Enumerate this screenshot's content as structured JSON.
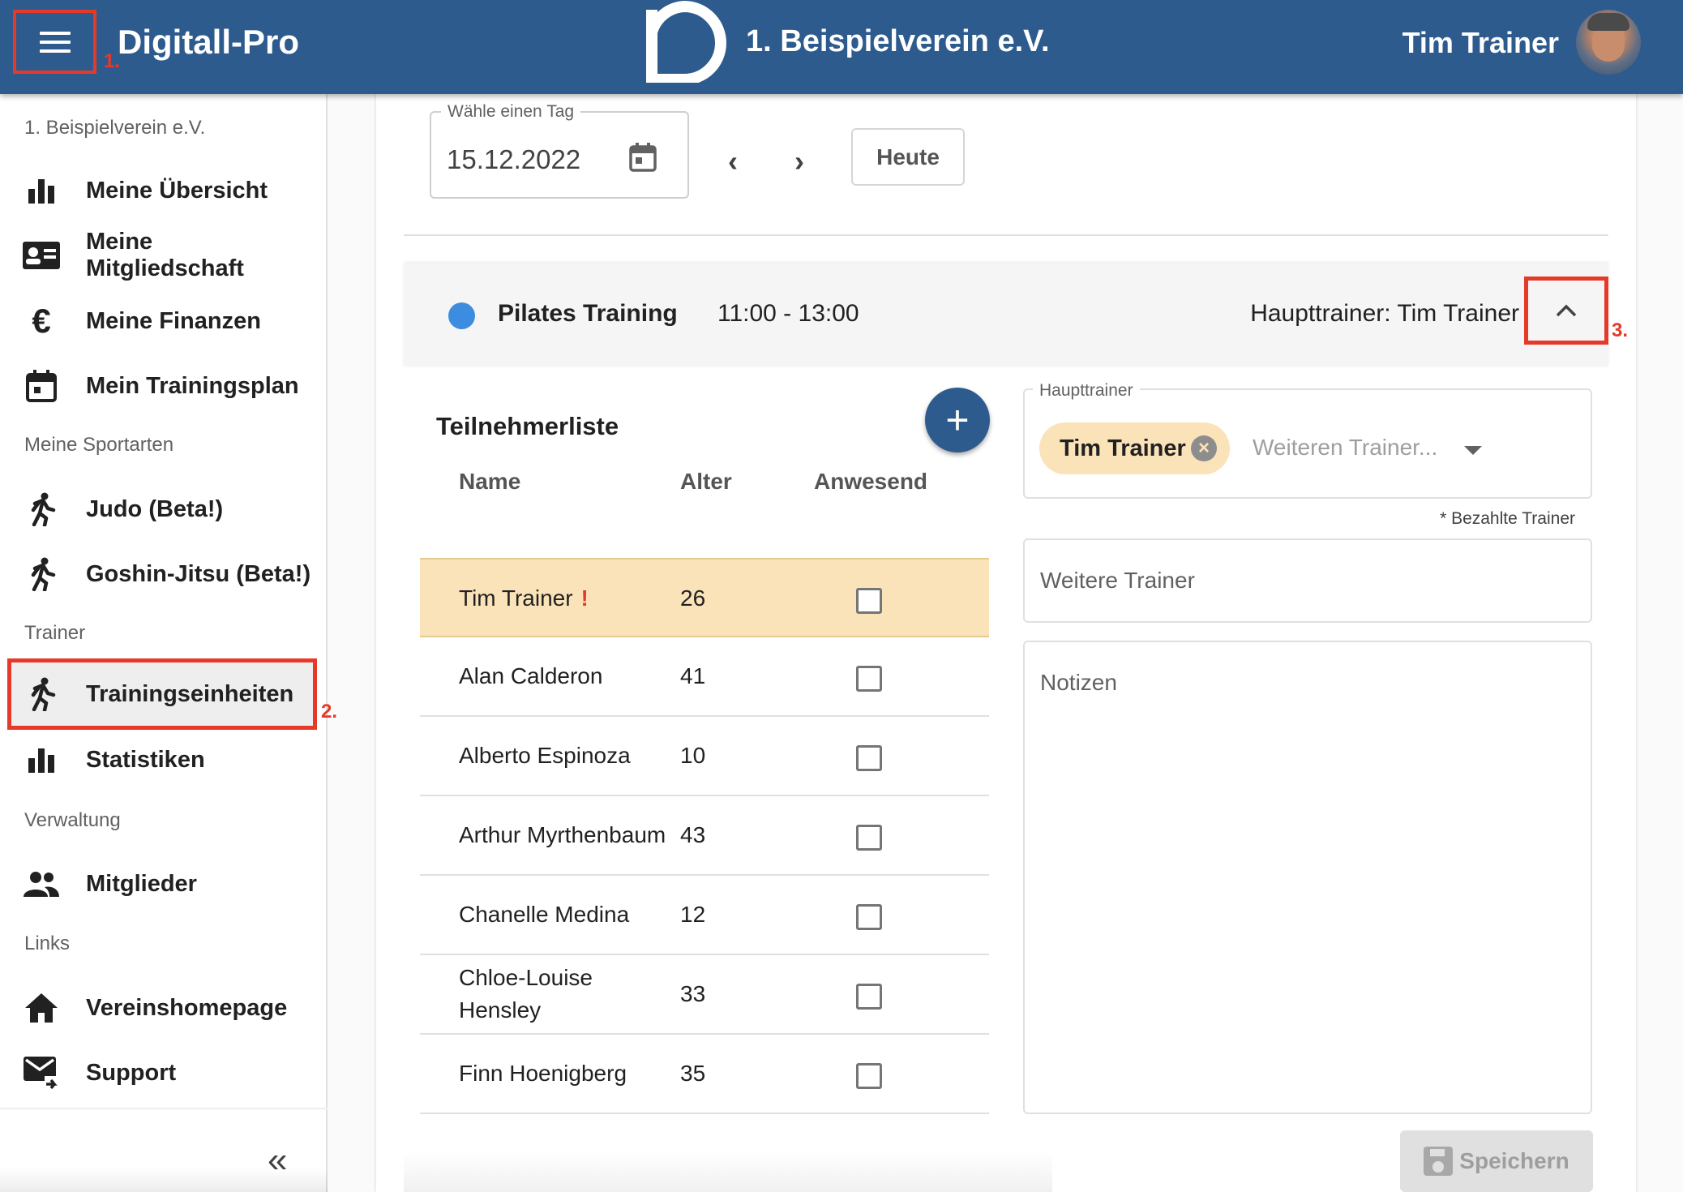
{
  "header": {
    "app_title": "Digitall-Pro",
    "club_title": "1. Beispielverein e.V.",
    "user_name": "Tim Trainer",
    "annotation_menu": "1."
  },
  "sidebar": {
    "club_caption": "1. Beispielverein e.V.",
    "items_personal": [
      {
        "label": "Meine Übersicht",
        "icon": "bar-chart-icon"
      },
      {
        "label": "Meine Mitgliedschaft",
        "icon": "id-card-icon"
      },
      {
        "label": "Meine Finanzen",
        "icon": "euro-icon"
      },
      {
        "label": "Mein Trainingsplan",
        "icon": "calendar-icon"
      }
    ],
    "sports_caption": "Meine Sportarten",
    "items_sports": [
      {
        "label": "Judo (Beta!)",
        "icon": "runner-icon"
      },
      {
        "label": "Goshin-Jitsu (Beta!)",
        "icon": "runner-icon"
      }
    ],
    "trainer_caption": "Trainer",
    "items_trainer": [
      {
        "label": "Trainingseinheiten",
        "icon": "runner-icon"
      },
      {
        "label": "Statistiken",
        "icon": "bar-chart-icon"
      }
    ],
    "admin_caption": "Verwaltung",
    "items_admin": [
      {
        "label": "Mitglieder",
        "icon": "people-icon"
      }
    ],
    "links_caption": "Links",
    "items_links": [
      {
        "label": "Vereinshomepage",
        "icon": "home-icon"
      },
      {
        "label": "Support",
        "icon": "mail-forward-icon"
      }
    ],
    "annotation_active": "2.",
    "collapse_label": "«"
  },
  "datebar": {
    "label": "Wähle einen Tag",
    "value": "15.12.2022",
    "prev": "‹",
    "next": "›",
    "today": "Heute"
  },
  "training": {
    "name": "Pilates Training",
    "time": "11:00 - 13:00",
    "main_trainer": "Haupttrainer: Tim Trainer",
    "dot_color": "#3c8ddf",
    "annotation_collapse": "3."
  },
  "participants": {
    "title": "Teilnehmerliste",
    "add_label": "+",
    "columns": [
      "Name",
      "Alter",
      "Anwesend"
    ],
    "rows": [
      {
        "name": "Tim Trainer",
        "age": "26",
        "flag": "!",
        "present": false
      },
      {
        "name": "Alan Calderon",
        "age": "41",
        "present": false
      },
      {
        "name": "Alberto Espinoza",
        "age": "10",
        "present": false
      },
      {
        "name": "Arthur Myrthenbaum",
        "age": "43",
        "present": false
      },
      {
        "name": "Chanelle Medina",
        "age": "12",
        "present": false
      },
      {
        "name": "Chloe-Louise",
        "name2": "Hensley",
        "age": "33",
        "present": false
      },
      {
        "name": "Finn Hoenigberg",
        "age": "35",
        "present": false
      }
    ]
  },
  "trainer_form": {
    "main_label": "Haupttrainer",
    "chip": "Tim Trainer",
    "chip_remove": "×",
    "more_placeholder": "Weiteren Trainer...",
    "paid_note": "* Bezahlte Trainer",
    "further_placeholder": "Weitere Trainer",
    "notes_placeholder": "Notizen",
    "save_label": "Speichern"
  },
  "colors": {
    "header": "#2e5b8e",
    "highlight": "#fbe3b9",
    "annotation": "#e53a2a"
  }
}
